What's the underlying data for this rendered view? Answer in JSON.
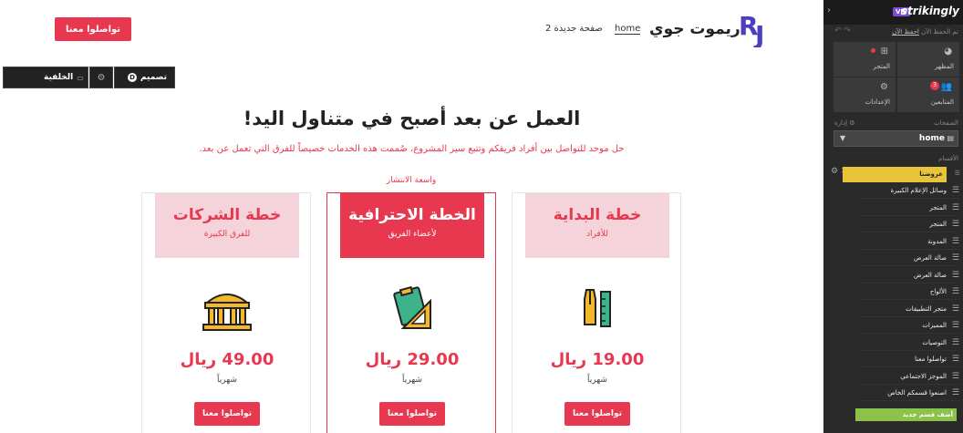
{
  "header": {
    "cta_label": "تواصلوا معنا",
    "brand_name": "ريموت جوي",
    "nav": [
      "home",
      "صفحة جديدة 2"
    ]
  },
  "editbar": {
    "background_label": "الخلفية",
    "design_label": "تصميم",
    "design_badge": "D"
  },
  "hero": {
    "title": "العمل عن بعد أصبح في متناول اليد!",
    "subtitle": "حل موحد للتواصل بين أفراد فريقكم وتتبع سير المشروع، صُممت هذه الخدمات خصيصاً للفرق التي تعمل عن بعد."
  },
  "pricing": {
    "popular_label": "واسعة الانتشار",
    "plans": [
      {
        "title": "خطة الشركات",
        "subtitle": "للفرق الكبيرة",
        "price": "49.00 ريال",
        "period": "شهرياً",
        "cta": "تواصلوا معنا",
        "icon": "building-icon"
      },
      {
        "title": "الخطة الاحترافية",
        "subtitle": "لأعضاء الفريق",
        "price": "29.00 ريال",
        "period": "شهرياً",
        "cta": "تواصلوا معنا",
        "icon": "clipboard-ruler-icon"
      },
      {
        "title": "خطة البداية",
        "subtitle": "للأفراد",
        "price": "19.00 ريال",
        "period": "شهرياً",
        "cta": "تواصلوا معنا",
        "icon": "pen-ruler-icon"
      }
    ]
  },
  "sidebar": {
    "brand": "strikingly",
    "vip": "VIP",
    "saved_text": "تم الحفظ الآن",
    "save_link": "احفظ الآن",
    "tiles": [
      {
        "label": "المظهر",
        "icon": "palette-icon"
      },
      {
        "label": "المتجر",
        "icon": "shop-icon"
      },
      {
        "label": "المتابعين",
        "icon": "users-icon",
        "badge": "3"
      },
      {
        "label": "الإعدادات",
        "icon": "gear-icon"
      }
    ],
    "pages_label": "الصفحات",
    "manage_label": "إدارة",
    "current_page": "home",
    "sections_label": "الأقسام",
    "sections": [
      "عروضنا",
      "وسائل الإعلام الكبيرة",
      "المتجر",
      "المتجر",
      "المدونة",
      "صالة العرض",
      "صالة العرض",
      "الألواح",
      "متجر التطبيقات",
      "المميزات",
      "التوصيات",
      "تواصلوا معنا",
      "الموجز الاجتماعي",
      "اصنعوا قسمكم الخاص"
    ],
    "add_section": "أضف قسم جديد"
  },
  "colors": {
    "accent": "#e8384f",
    "accent_light": "#f4d3da",
    "sidebar_bg": "#2a2a2a",
    "active_section": "#e8c43a",
    "add_button": "#8bc34a",
    "vip": "#7b4fd4"
  }
}
